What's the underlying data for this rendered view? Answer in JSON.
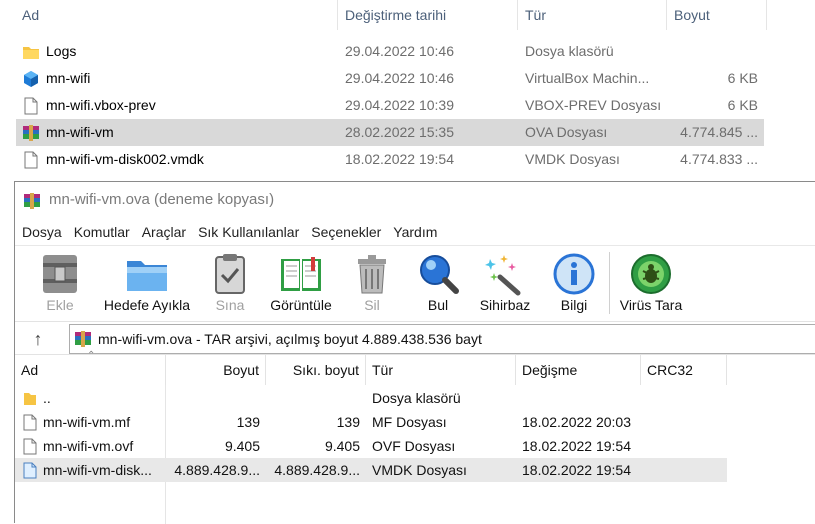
{
  "explorer": {
    "columns": {
      "name": "Ad",
      "date": "Değiştirme tarihi",
      "type": "Tür",
      "size": "Boyut"
    },
    "rows": [
      {
        "icon": "folder-icon",
        "name": "Logs",
        "date": "29.04.2022 10:46",
        "type": "Dosya klasörü",
        "size": ""
      },
      {
        "icon": "virtualbox-icon",
        "name": "mn-wifi",
        "date": "29.04.2022 10:46",
        "type": "VirtualBox Machin...",
        "size": "6 KB"
      },
      {
        "icon": "file-icon",
        "name": "mn-wifi.vbox-prev",
        "date": "29.04.2022 10:39",
        "type": "VBOX-PREV Dosyası",
        "size": "6 KB"
      },
      {
        "icon": "winrar-archive-icon",
        "name": "mn-wifi-vm",
        "date": "28.02.2022 15:35",
        "type": "OVA Dosyası",
        "size": "4.774.845 ..."
      },
      {
        "icon": "file-icon",
        "name": "mn-wifi-vm-disk002.vmdk",
        "date": "18.02.2022 19:54",
        "type": "VMDK Dosyası",
        "size": "4.774.833 ..."
      }
    ]
  },
  "winrar": {
    "title": "mn-wifi-vm.ova (deneme kopyası)",
    "menu": [
      "Dosya",
      "Komutlar",
      "Araçlar",
      "Sık Kullanılanlar",
      "Seçenekler",
      "Yardım"
    ],
    "toolbar": {
      "add": "Ekle",
      "extract": "Hedefe Ayıkla",
      "test": "Sına",
      "view": "Görüntüle",
      "delete": "Sil",
      "find": "Bul",
      "wizard": "Sihirbaz",
      "info": "Bilgi",
      "virus": "Virüs Tara"
    },
    "path_text": "mn-wifi-vm.ova - TAR arşivi, açılmış boyut 4.889.438.536 bayt",
    "list_columns": {
      "name": "Ad",
      "size": "Boyut",
      "packed": "Sıkı. boyut",
      "type": "Tür",
      "modified": "Değişme",
      "crc": "CRC32"
    },
    "files": [
      {
        "icon": "folder-icon",
        "name": "..",
        "size": "",
        "packed": "",
        "type": "Dosya klasörü",
        "modified": ""
      },
      {
        "icon": "file-icon",
        "name": "mn-wifi-vm.mf",
        "size": "139",
        "packed": "139",
        "type": "MF Dosyası",
        "modified": "18.02.2022 20:03"
      },
      {
        "icon": "file-icon",
        "name": "mn-wifi-vm.ovf",
        "size": "9.405",
        "packed": "9.405",
        "type": "OVF Dosyası",
        "modified": "18.02.2022 19:54"
      },
      {
        "icon": "vmdk-file-icon",
        "name": "mn-wifi-vm-disk...",
        "size": "4.889.428.9...",
        "packed": "4.889.428.9...",
        "type": "VMDK Dosyası",
        "modified": "18.02.2022 19:54"
      }
    ]
  }
}
